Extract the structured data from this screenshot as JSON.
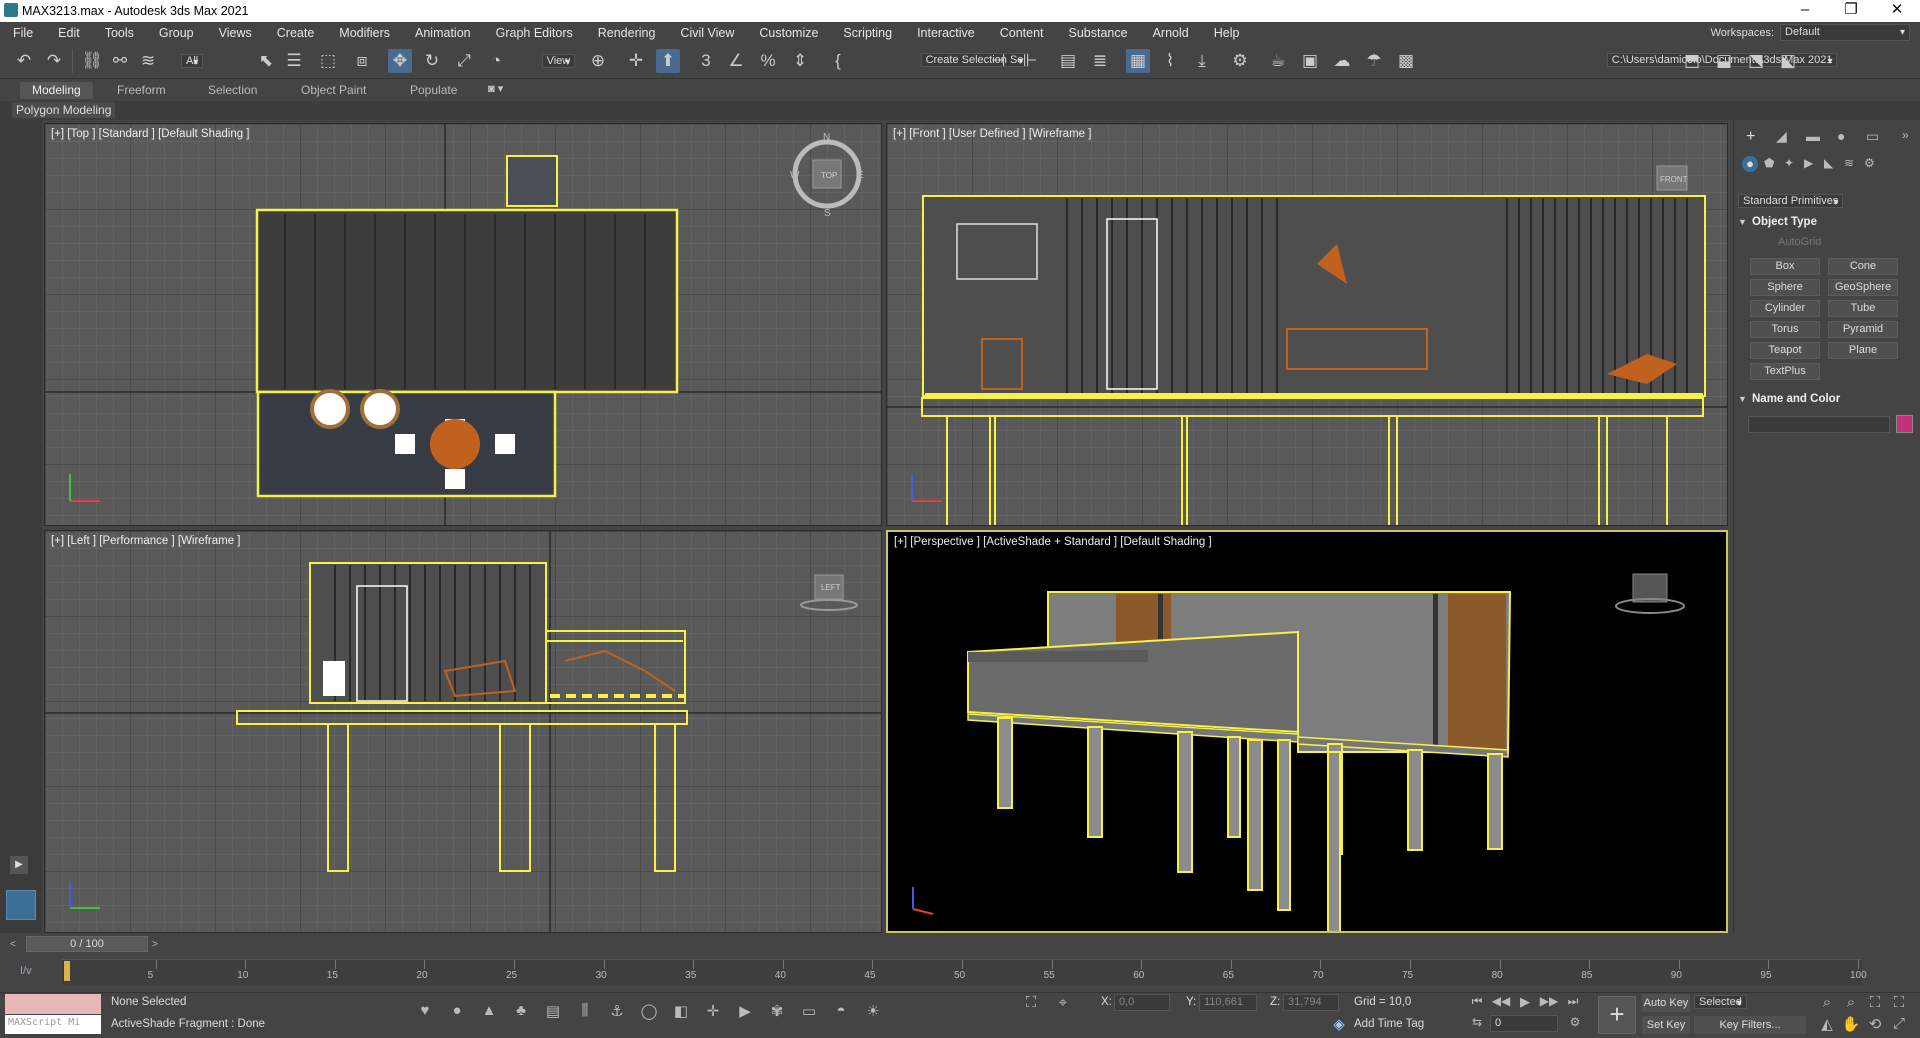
{
  "window": {
    "title": "MAX3213.max - Autodesk 3ds Max 2021",
    "minimize": "–",
    "maximize": "❐",
    "close": "✕"
  },
  "menu": [
    "File",
    "Edit",
    "Tools",
    "Group",
    "Views",
    "Create",
    "Modifiers",
    "Animation",
    "Graph Editors",
    "Rendering",
    "Civil View",
    "Customize",
    "Scripting",
    "Interactive",
    "Content",
    "Substance",
    "Arnold",
    "Help"
  ],
  "workspaces": {
    "label": "Workspaces:",
    "value": "Default"
  },
  "toolbar": {
    "filter": "All",
    "refcoord": "View",
    "selection_set": "Create Selection Se",
    "project_path": "C:\\Users\\damicelo\\Documents\\3ds Max 2021"
  },
  "ribbon_tabs": [
    "Modeling",
    "Freeform",
    "Selection",
    "Object Paint",
    "Populate"
  ],
  "ribbon_panel": "Polygon Modeling",
  "viewports": {
    "top": "[+] [Top ] [Standard ] [Default Shading ]",
    "front": "[+] [Front ] [User Defined ] [Wireframe ]",
    "left": "[+] [Left ] [Performance ] [Wireframe ]",
    "persp": "[+] [Perspective ] [ActiveShade + Standard ] [Default Shading ]"
  },
  "viewcube": {
    "top": "TOP",
    "front": "FRONT",
    "left": "LEFT",
    "compass_n": "N",
    "compass_s": "S",
    "compass_e": "E",
    "compass_w": "W"
  },
  "command_panel": {
    "category": "Standard Primitives",
    "object_type": "Object Type",
    "autogrid": "AutoGrid",
    "buttons": [
      "Box",
      "Cone",
      "Sphere",
      "GeoSphere",
      "Cylinder",
      "Tube",
      "Torus",
      "Pyramid",
      "Teapot",
      "Plane",
      "TextPlus"
    ],
    "name_color": "Name and Color",
    "color": "#c4307a"
  },
  "timeline": {
    "frame": "0 / 100",
    "ticks": [
      "5",
      "10",
      "15",
      "20",
      "25",
      "30",
      "35",
      "40",
      "45",
      "50",
      "55",
      "60",
      "65",
      "70",
      "75",
      "80",
      "85",
      "90",
      "95",
      "100"
    ]
  },
  "status": {
    "selection": "None Selected",
    "message": "ActiveShade Fragment : Done",
    "maxscript": "MAXScript Mi",
    "x_label": "X:",
    "x": "0,0",
    "y_label": "Y:",
    "y": "110,661",
    "z_label": "Z:",
    "z": "31,794",
    "grid": "Grid = 10,0",
    "add_time_tag": "Add Time Tag",
    "auto_key": "Auto Key",
    "set_key": "Set Key",
    "key_mode": "Selected",
    "key_filters": "Key Filters...",
    "frame_field": "0"
  }
}
